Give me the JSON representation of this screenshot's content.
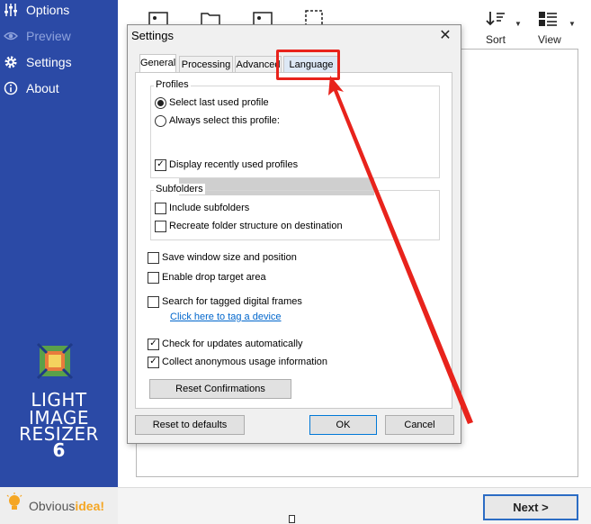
{
  "sidebar": {
    "items": [
      {
        "label": "Options",
        "icon": "sliders-icon",
        "active": false
      },
      {
        "label": "Preview",
        "icon": "eye-icon",
        "active": false
      },
      {
        "label": "Settings",
        "icon": "gear-icon",
        "active": true
      },
      {
        "label": "About",
        "icon": "info-icon",
        "active": false
      }
    ],
    "brand": {
      "line1": "LIGHT",
      "line2": "IMAGE",
      "line3": "RESIZER",
      "version": "6"
    },
    "company": {
      "prefix": "Obvious",
      "suffix": "idea!"
    }
  },
  "toolbar": {
    "sort_label": "Sort",
    "view_label": "View"
  },
  "footer": {
    "next_label": "Next >"
  },
  "dialog": {
    "title": "Settings",
    "close_glyph": "✕",
    "tabs": [
      {
        "label": "General",
        "active": true
      },
      {
        "label": "Processing",
        "active": false
      },
      {
        "label": "Advanced",
        "active": false
      },
      {
        "label": "Language",
        "active": false
      }
    ],
    "profiles": {
      "group_label": "Profiles",
      "radio_last_used": "Select last used profile",
      "radio_always": "Always select this profile:",
      "selected_option": "Select last used profile",
      "profile_value": "",
      "display_recent": "Display recently used profiles",
      "display_recent_checked": true
    },
    "subfolders": {
      "group_label": "Subfolders",
      "include": "Include subfolders",
      "include_checked": false,
      "recreate": "Recreate folder structure on destination",
      "recreate_checked": false
    },
    "options": [
      {
        "label": "Save window size and position",
        "checked": false
      },
      {
        "label": "Enable drop target area",
        "checked": false
      },
      {
        "label": "Search for tagged digital frames",
        "checked": false
      }
    ],
    "tag_link": "Click here to tag a device",
    "updates": [
      {
        "label": "Check for updates automatically",
        "checked": true
      },
      {
        "label": "Collect anonymous usage information",
        "checked": true
      }
    ],
    "reset_confirmations": "Reset Confirmations",
    "reset_defaults": "Reset to defaults",
    "ok": "OK",
    "cancel": "Cancel"
  },
  "colors": {
    "sidebar": "#2b4aa6",
    "highlight": "#e8231c",
    "link": "#0066cc",
    "accent": "#0078d7"
  }
}
